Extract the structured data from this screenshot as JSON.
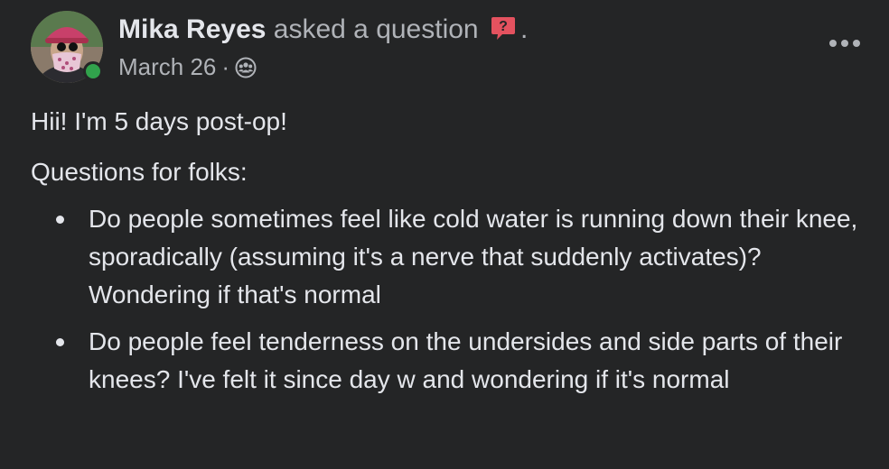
{
  "post": {
    "author_name": "Mika Reyes",
    "action_text": "asked a question",
    "trailing_text": ".",
    "timestamp": "March 26",
    "separator": "·",
    "audience_icon": "group-icon",
    "question_badge_icon": "question-mark-speech-bubble-icon",
    "more_options_icon": "more-horizontal-icon",
    "online": true,
    "intro": "Hii! I'm 5 days post-op!",
    "lead_in": "Questions for folks:",
    "questions": [
      "Do people sometimes feel like cold water is running down their knee, sporadically (assuming it's a nerve that suddenly activates)? Wondering if that's normal",
      "Do people feel tenderness on the undersides and side parts of their knees? I've felt it since day w and wondering if it's normal"
    ]
  },
  "colors": {
    "background": "#242526",
    "primary_text": "#e4e6eb",
    "secondary_text": "#b0b3b8",
    "online_green": "#31a24c",
    "question_badge": "#e4525f"
  }
}
